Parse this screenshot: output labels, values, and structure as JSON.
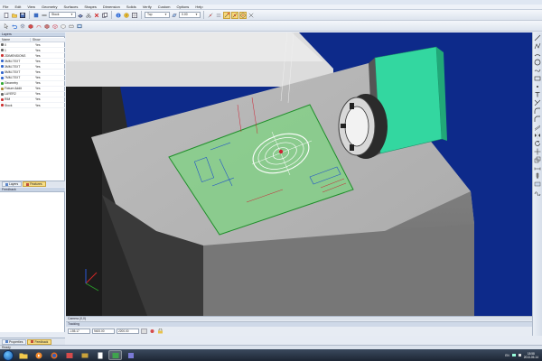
{
  "app": {
    "title": ""
  },
  "menu": [
    "File",
    "Edit",
    "View",
    "Geometry",
    "Surfaces",
    "Shapes",
    "Dimension",
    "Solids",
    "Verify",
    "Custom",
    "Options",
    "Help"
  ],
  "toolbar1": {
    "material_select": "Stock",
    "view_select": "Top",
    "zoom_value": "0.00"
  },
  "layers": {
    "title": "Layers",
    "columns": [
      "Name",
      "Show"
    ],
    "rows": [
      {
        "name": "0",
        "show": "Yes",
        "color": "#666666"
      },
      {
        "name": "1",
        "show": "Yes",
        "color": "#666666"
      },
      {
        "name": "2DIMENSIONS",
        "show": "Yes",
        "color": "#cc3333"
      },
      {
        "name": "3MM-TEXT",
        "show": "Yes",
        "color": "#3366cc"
      },
      {
        "name": "3MM-TEXT",
        "show": "Yes",
        "color": "#3366cc"
      },
      {
        "name": "5MM-TEXT",
        "show": "Yes",
        "color": "#3366cc"
      },
      {
        "name": "7MM-TEXT",
        "show": "Yes",
        "color": "#3366cc"
      },
      {
        "name": "Geometry",
        "show": "Yes",
        "color": "#33aa33"
      },
      {
        "name": "Fixture Addit",
        "show": "Yes",
        "color": "#aa8833"
      },
      {
        "name": "LAYER2",
        "show": "Yes",
        "color": "#666666"
      },
      {
        "name": "RIM",
        "show": "Yes",
        "color": "#cc3333"
      },
      {
        "name": "Stock",
        "show": "Yes",
        "color": "#cc3333"
      }
    ]
  },
  "left_tabs": [
    "Layers",
    "Features"
  ],
  "feedback": {
    "title": "Feedback"
  },
  "bottom_tabs": [
    "Properties",
    "Feedback"
  ],
  "viewport": {
    "status": "Camera (0,0)"
  },
  "tracking": {
    "title": "Tracking",
    "x": "-155.17",
    "y": "9400.00",
    "z": "2200.00"
  },
  "app_status": "Ready",
  "taskbar": {
    "lang": "EN",
    "time": "18:58",
    "date": "2013-05-14"
  },
  "colors": {
    "viewport_bg": "#0d2a8a",
    "stock_green": "#33d7a0",
    "active_tab": "#f8df88"
  }
}
